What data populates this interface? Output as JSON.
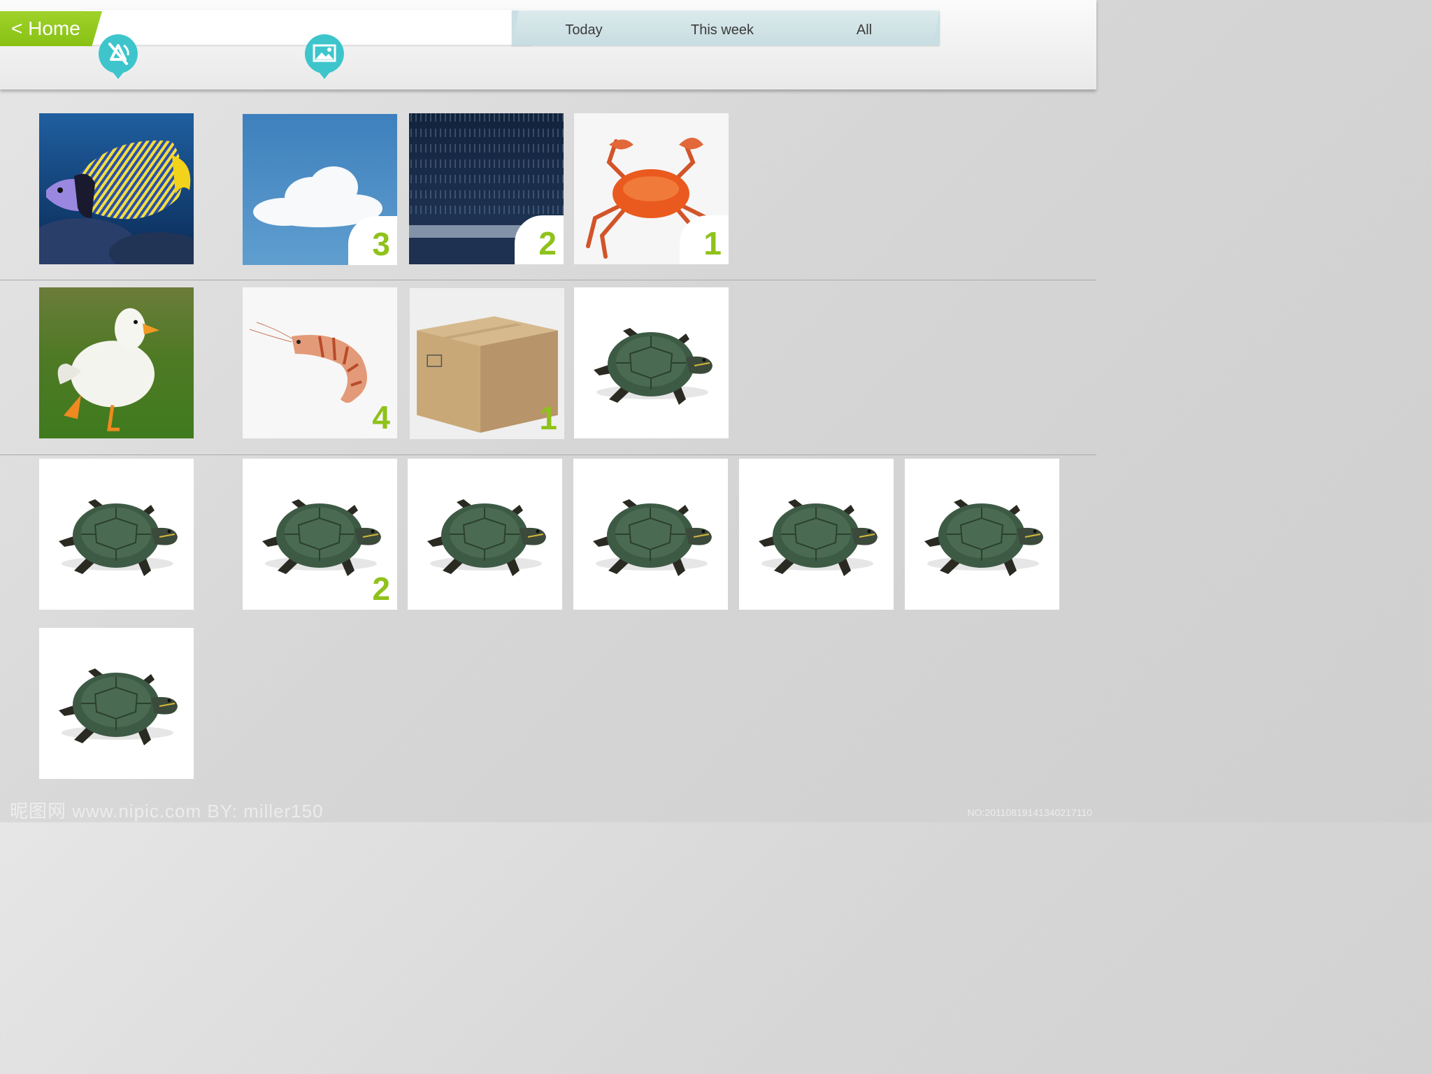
{
  "header": {
    "home_label": "< Home",
    "tabs": [
      {
        "label": "Today"
      },
      {
        "label": "This week"
      },
      {
        "label": "All"
      }
    ],
    "pins": [
      {
        "icon": "no-audio-icon"
      },
      {
        "icon": "image-icon"
      }
    ],
    "accent_color": "#8fc21a",
    "pin_color": "#3ec5cc"
  },
  "grid": {
    "rows": [
      {
        "lead": {
          "subject": "tropical fish"
        },
        "items": [
          {
            "subject": "cloud",
            "count": "3"
          },
          {
            "subject": "rain",
            "count": "2"
          },
          {
            "subject": "crab",
            "count": "1"
          }
        ]
      },
      {
        "lead": {
          "subject": "duck"
        },
        "items": [
          {
            "subject": "shrimp",
            "count": "4"
          },
          {
            "subject": "cardboard box",
            "count": "1"
          },
          {
            "subject": "turtle",
            "count": ""
          }
        ]
      },
      {
        "lead": {
          "subject": "turtle"
        },
        "items": [
          {
            "subject": "turtle",
            "count": "2"
          },
          {
            "subject": "turtle",
            "count": ""
          },
          {
            "subject": "turtle",
            "count": ""
          },
          {
            "subject": "turtle",
            "count": ""
          },
          {
            "subject": "turtle",
            "count": ""
          }
        ]
      },
      {
        "lead": {
          "subject": "turtle"
        },
        "items": []
      }
    ]
  },
  "watermark": {
    "left": "昵图网 www.nipic.com    BY: miller150",
    "right": "NO:20110819141340217110"
  }
}
